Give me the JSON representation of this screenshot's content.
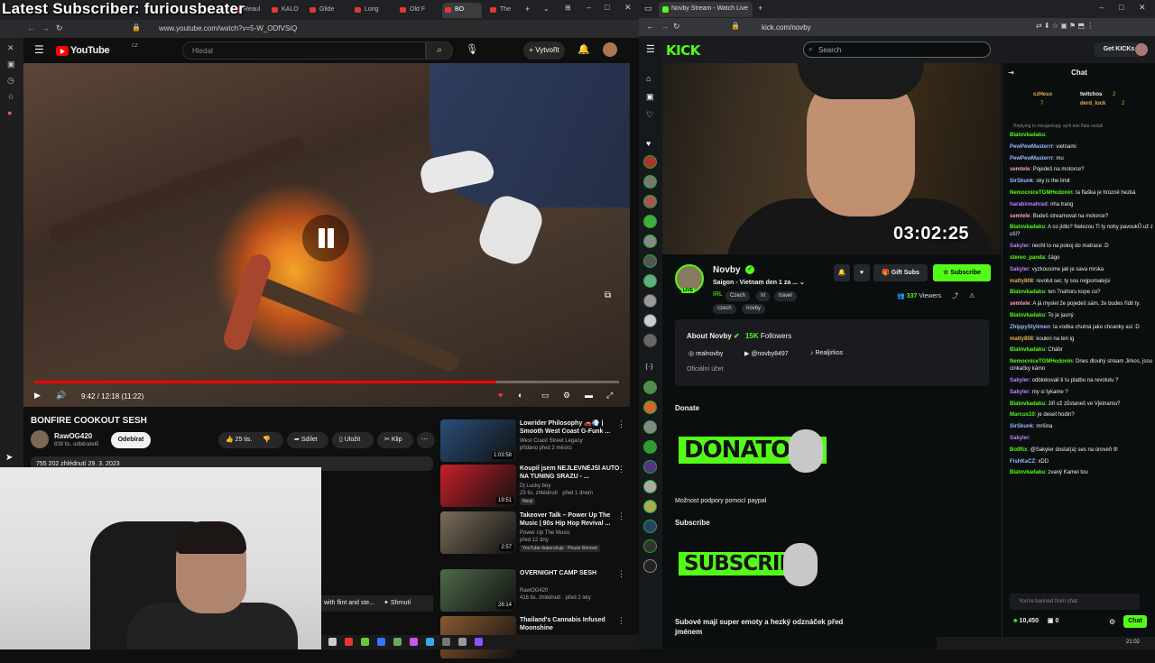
{
  "overlay": {
    "text": "Latest Subscriber: furiousbeater"
  },
  "left_browser": {
    "tabs": [
      "Reaul",
      "KALO",
      "Glide",
      "Long",
      "Old F",
      "BO",
      "The"
    ],
    "url": "www.youtube.com/watch?v=5-W_ODfVSiQ",
    "youtube": {
      "logo": "YouTube",
      "country": "CZ",
      "search_placeholder": "Hledat",
      "create": "Vytvořit",
      "time": "9:42 / 12:18 (11:22)",
      "progress": 0.79,
      "video_title": "BONFIRE COOKOUT SESH",
      "channel": "RawOG420",
      "subs": "839 tis. odběratelů",
      "subscribe": "Odebírat",
      "likes": "25 tis.",
      "share": "Sdílet",
      "save": "Uložit",
      "clip": "Klip",
      "more": "⋯",
      "views_date": "755 202 zhlédnutí  29. 3. 2023",
      "chapter_strip": "with flint and ste...",
      "summarize": "Shrnutí",
      "recommended": [
        {
          "title": "Lowrider Philosophy 🚗💨 | Smooth West Coast G-Funk ...",
          "channel": "West Coast Street Legacy",
          "meta": "přidáno před 2 měsíci",
          "badge": "",
          "duration": "1:03:58",
          "thumb": "#2a4f7a"
        },
        {
          "title": "Koupil jsem NEJLEVNĚJŠÍ AUTO NA TUNING SRAZU - ...",
          "channel": "Dj Lucky boy",
          "meta": "23 tis. zhlédnutí · před 1 dnem",
          "badge": "Nový",
          "duration": "19:51",
          "thumb": "#c8202a"
        },
        {
          "title": "Takeover Talk – Power Up The Music | 90s Hip Hop Revival ...",
          "channel": "Power Up The Music",
          "meta": "před 12 dny",
          "badge": "YouTube doporučuje · Pouze členové",
          "duration": "2:57",
          "thumb": "#7a6c5a"
        },
        {
          "title": "OVERNIGHT CAMP SESH",
          "channel": "RawOG420",
          "meta": "416 tis. zhlédnutí · před 2 lety",
          "badge": "",
          "duration": "28:14",
          "thumb": "#4f6a4a"
        },
        {
          "title": "Thailand's Cannabis Infused Moonshine",
          "channel": "",
          "meta": "",
          "badge": "",
          "duration": "",
          "thumb": "#8a5a32"
        }
      ]
    }
  },
  "right_browser": {
    "tab": "Novby Stream - Watch Live",
    "url": "kick.com/novby",
    "kick": {
      "logo": "KICK",
      "search_placeholder": "Search",
      "get_kicks": "Get KICKs",
      "timer": "03:02:25",
      "streamer": "Novby",
      "live": "LIVE",
      "stream_title": "Saigon - Vietnam den 1 za ...",
      "category": "IRL",
      "tags": [
        "Czech",
        "Irl",
        "travel",
        "czech",
        "novby"
      ],
      "viewers": "337",
      "viewers_label": "Viewers",
      "gift_subs": "Gift Subs",
      "subscribe": "Subscribe",
      "about_title": "About Novby",
      "followers": "15K",
      "followers_label": "Followers",
      "socials": [
        "realnovby",
        "@novby8497",
        "Realjirkos"
      ],
      "official": "Oficiální účet",
      "donate_heading": "Donate",
      "donate_img_text": "DONATOSS",
      "donate_caption": "Možnost podpory pomocí paypal",
      "subscribe_heading": "Subscribe",
      "subscribe_img_text": "SUBSCRIBE",
      "subscribe_caption": "Subové mají super emoty a hezký odznáček před jménem"
    },
    "chat": {
      "title": "Chat",
      "top_gifters": [
        {
          "name": "czHeso",
          "count": "7"
        },
        {
          "name": "twitchos",
          "count": "2"
        },
        {
          "name": "derd_luck",
          "count": "2"
        }
      ],
      "replying": "Replying to trávajedxpg: spíš kde flata nedali",
      "messages": [
        {
          "user": "Blatovkadaku",
          "text": "",
          "color": "#53fc18"
        },
        {
          "user": "PewPewMasterrr",
          "text": "vietnami",
          "color": "#9ab8ff"
        },
        {
          "user": "PewPewMasterrr",
          "text": "mu",
          "color": "#9ab8ff"
        },
        {
          "user": "semtele",
          "text": "Pojedeš na motorce?",
          "color": "#f7a0c0"
        },
        {
          "user": "SirSkunk",
          "text": "sky is the limit",
          "color": "#9ab8ff"
        },
        {
          "user": "NemocniceTGMHodonin",
          "text": "ta flaška je hrozně hezká",
          "color": "#53fc18"
        },
        {
          "user": "harabinnahrad",
          "text": "nha trang",
          "color": "#c080ff"
        },
        {
          "user": "semtele",
          "text": "Budeš streamovat na motorce?",
          "color": "#f7a0c0"
        },
        {
          "user": "Blatovkadaku",
          "text": "A co jídlo? Nelezou Ti ty nohy pavoukŮ už z uší?",
          "color": "#53fc18"
        },
        {
          "user": "Sakyler",
          "text": "necht to na pokoj do matrace :D",
          "color": "#c080ff"
        },
        {
          "user": "stereo_panda",
          "text": "čágo",
          "color": "#53fc18"
        },
        {
          "user": "Sakyler",
          "text": "vyzkousime jak je sava mrska",
          "color": "#c080ff"
        },
        {
          "user": "matty808",
          "text": "revolut ser, ty sou nejpomalejsi",
          "color": "#e0b050"
        },
        {
          "user": "Blatovkadaku",
          "text": "ten 7nahoru kope co?",
          "color": "#53fc18"
        },
        {
          "user": "semtele",
          "text": "A já myslel že pojedeš sám, že budes řídit ty.",
          "color": "#f7a0c0"
        },
        {
          "user": "Blatovkadaku",
          "text": "To je jasný",
          "color": "#53fc18"
        },
        {
          "user": "ZhippyStylimen",
          "text": "ta vodka chutná jako chcanky asi :D",
          "color": "#9ab8ff"
        },
        {
          "user": "matty808",
          "text": "koukni na ten ig",
          "color": "#e0b050"
        },
        {
          "user": "Blatovkadaku",
          "text": "Chábr",
          "color": "#53fc18"
        },
        {
          "user": "NemocniceTGMHodonin",
          "text": "Dnes dlouhý stream Jirkos, jsou cinkačky kámo",
          "color": "#53fc18"
        },
        {
          "user": "Sakyler",
          "text": "odblokovali ti tu platbu na revolutu ?",
          "color": "#c080ff"
        },
        {
          "user": "Sakyler",
          "text": "my si tykame ?",
          "color": "#c080ff"
        },
        {
          "user": "Blatovkadaku",
          "text": "Jiří už zůstaneš ve Vjetnamu?",
          "color": "#53fc18"
        },
        {
          "user": "Marcus10",
          "text": "je deset hodin?",
          "color": "#53fc18"
        },
        {
          "user": "SirSkunk",
          "text": "mršina",
          "color": "#9ab8ff"
        },
        {
          "user": "Sakyler",
          "text": "",
          "color": "#c080ff"
        },
        {
          "user": "BotRix",
          "text": "@Sakyler dostal(a) ses na úroveň 9!",
          "color": "#53fc18"
        },
        {
          "user": "FishKaCZ",
          "text": "xDD",
          "color": "#9ab8ff"
        },
        {
          "user": "Blatovkadaku",
          "text": "zvaný Kamei tou",
          "color": "#53fc18"
        }
      ],
      "input_placeholder": "You're banned from chat",
      "send": "Chat",
      "points": "10,450",
      "zero": "0"
    },
    "clock": "21:02"
  }
}
